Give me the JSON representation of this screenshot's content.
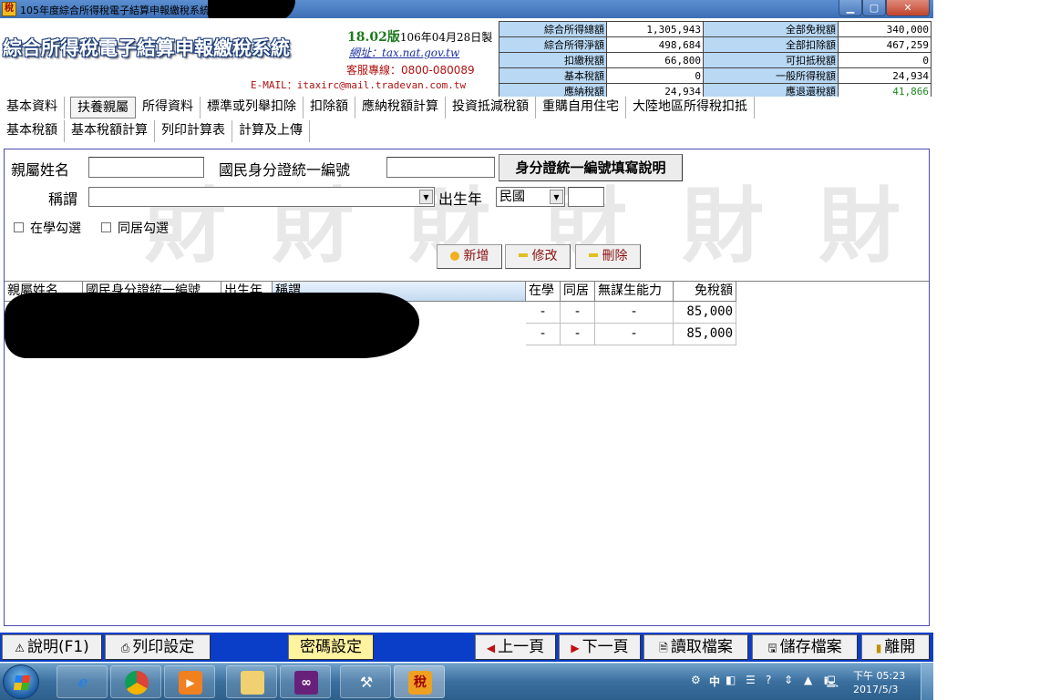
{
  "window": {
    "title": "105年度綜合所得稅電子結算申報繳稅系統",
    "app_icon_glyph": "稅"
  },
  "header": {
    "logo_text": "綜合所得稅電子結算申報繳稅系統",
    "version": "18.02版",
    "version_date": "106年04月28日製",
    "website_label": "網址：",
    "website_url": "tax.nat.gov.tw",
    "hotline": "客服專線：0800-080089",
    "email": "E-MAIL：itaxirc@mail.tradevan.com.tw",
    "summary": [
      {
        "label": "綜合所得總額",
        "value": "1,305,943",
        "label2": "全部免稅額",
        "value2": "340,000"
      },
      {
        "label": "綜合所得淨額",
        "value": "498,684",
        "label2": "全部扣除額",
        "value2": "467,259"
      },
      {
        "label": "扣繳稅額",
        "value": "66,800",
        "label2": "可扣抵稅額",
        "value2": "0"
      },
      {
        "label": "基本稅額",
        "value": "0",
        "label2": "一般所得稅額",
        "value2": "24,934"
      },
      {
        "label": "應納稅額",
        "value": "24,934",
        "label2": "應退還稅額",
        "value2": "41,866"
      }
    ],
    "refund_color": "#1e8a1e"
  },
  "menu": {
    "row1": [
      "基本資料",
      "扶養親屬",
      "所得資料",
      "標準或列舉扣除",
      "扣除額",
      "應納稅額計算",
      "投資抵減稅額",
      "重購自用住宅",
      "大陸地區所得稅扣抵"
    ],
    "row2": [
      "基本稅額",
      "基本稅額計算",
      "列印計算表",
      "計算及上傳"
    ],
    "active": "扶養親屬"
  },
  "form": {
    "name_label": "親屬姓名",
    "name_value": "",
    "id_label": "國民身分證統一編號",
    "id_value": "",
    "id_help_button": "身分證統一編號填寫說明",
    "relation_label": "稱謂",
    "relation_value": "",
    "birth_year_label": "出生年",
    "era_value": "民國",
    "birth_year_value": "",
    "in_school_label": "在學勾選",
    "cohabit_label": "同居勾選",
    "watermark_glyph": "財",
    "add_button": "新增",
    "edit_button": "修改",
    "delete_button": "刪除"
  },
  "grid": {
    "columns": [
      "親屬姓名",
      "國民身分證統一編號",
      "出生年",
      "稱謂",
      "在學",
      "同居",
      "無謀生能力",
      "免稅額"
    ],
    "rows": [
      {
        "in_school": "-",
        "cohabit": "-",
        "no_income": "-",
        "exemption": "85,000"
      },
      {
        "in_school": "-",
        "cohabit": "-",
        "no_income": "-",
        "exemption": "85,000"
      }
    ]
  },
  "bottom": {
    "help": "說明(F1)",
    "print_setup": "列印設定",
    "password": "密碼設定",
    "prev": "上一頁",
    "next": "下一頁",
    "read_file": "讀取檔案",
    "save_file": "儲存檔案",
    "exit": "離開"
  },
  "taskbar": {
    "ime": "中",
    "time": "下午 05:23",
    "date": "2017/5/3"
  }
}
